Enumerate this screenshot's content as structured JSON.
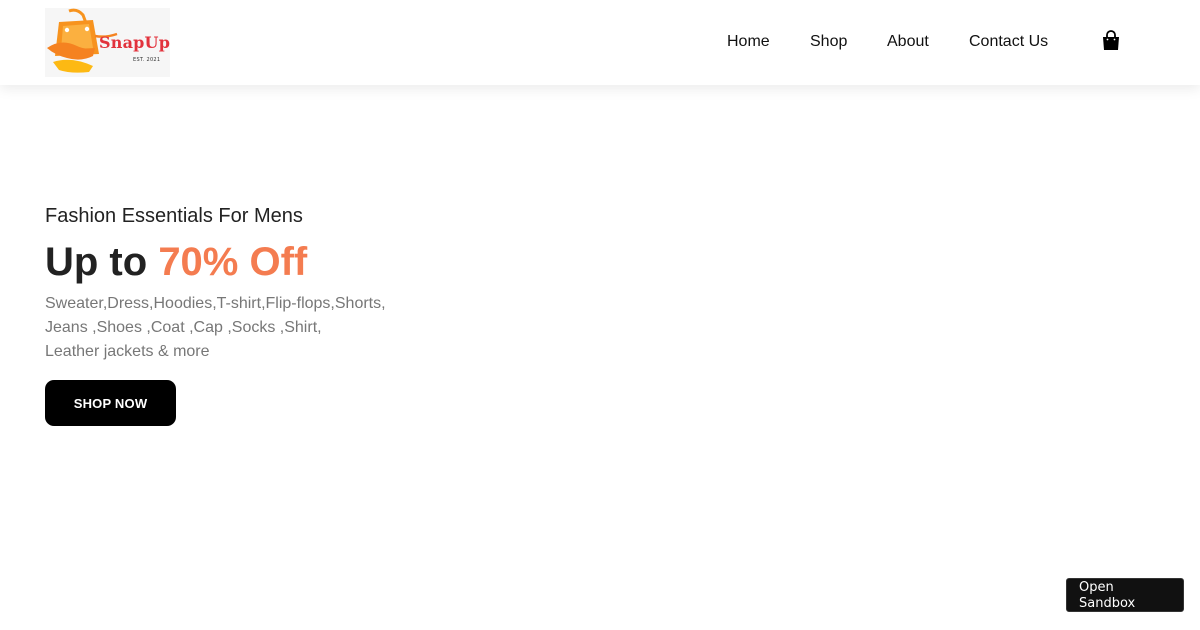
{
  "header": {
    "logo": {
      "brand": "SnapUp",
      "tagline": "EST. 2021",
      "icon": "shopping-bag-logo"
    },
    "nav": {
      "items": [
        {
          "label": "Home"
        },
        {
          "label": "Shop"
        },
        {
          "label": "About"
        },
        {
          "label": "Contact Us"
        }
      ],
      "cart_icon": "shopping-bag-icon"
    }
  },
  "hero": {
    "subtitle": "Fashion Essentials For Mens",
    "title_prefix": "Up to ",
    "title_accent": "70% Off",
    "description_lines": [
      "Sweater,Dress,Hoodies,T-shirt,Flip-flops,Shorts,",
      "Jeans ,Shoes ,Coat ,Cap ,Socks ,Shirt,",
      "Leather jackets & more"
    ],
    "cta_label": "SHOP NOW"
  },
  "sandbox": {
    "label": "Open Sandbox"
  },
  "colors": {
    "accent": "#f47c50",
    "logo_orange": "#f5a623",
    "logo_red": "#e2323c",
    "button": "#000000"
  }
}
